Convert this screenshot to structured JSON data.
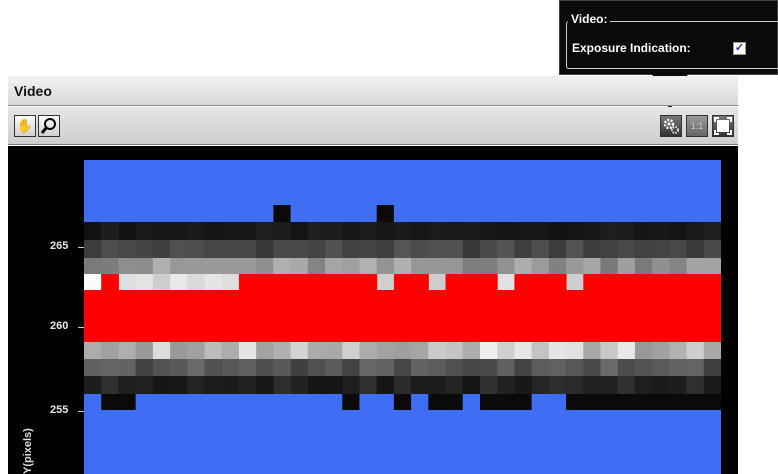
{
  "popup": {
    "legend": "Video:",
    "exposure_label": "Exposure Indication:",
    "exposure_checked": "✓"
  },
  "panel": {
    "title": "Video"
  },
  "toolbar": {
    "pan_icon": "hand-icon",
    "zoom_icon": "magnifier-icon",
    "settings_icon": "gear-icon",
    "onetoone_icon": "1:1",
    "fit_icon": "fit-to-window-icon"
  },
  "axis": {
    "ylabel": "Y(pixels)",
    "ticks": [
      "265",
      "260",
      "255"
    ]
  },
  "colors": {
    "saturated_high": "#ff0000",
    "saturated_low": "#3f6ef5"
  }
}
